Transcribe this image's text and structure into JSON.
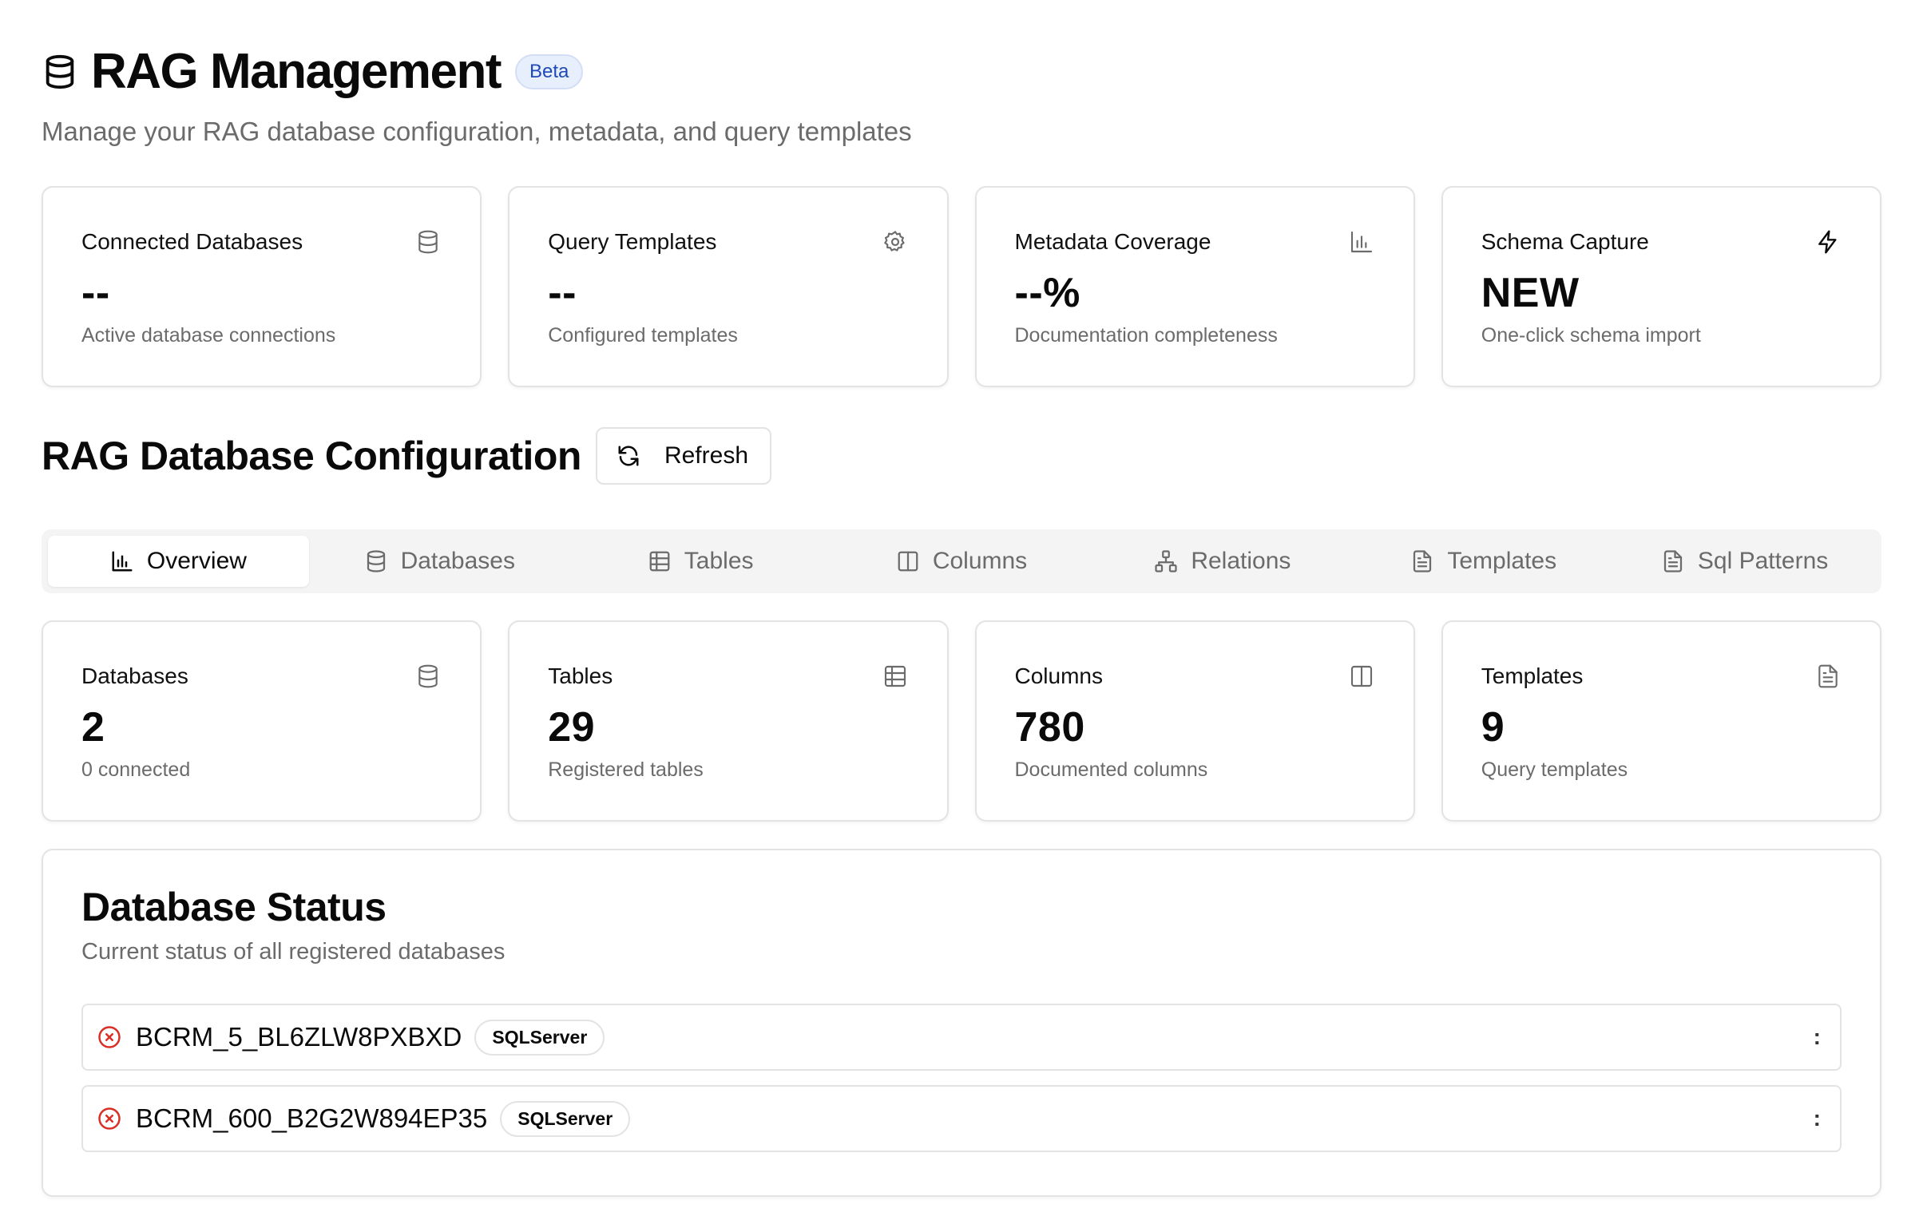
{
  "header": {
    "title": "RAG Management",
    "badge": "Beta",
    "subtitle": "Manage your RAG database configuration, metadata, and query templates"
  },
  "summary_cards": [
    {
      "title": "Connected Databases",
      "value": "--",
      "description": "Active database connections",
      "icon": "database-icon"
    },
    {
      "title": "Query Templates",
      "value": "--",
      "description": "Configured templates",
      "icon": "gear-icon"
    },
    {
      "title": "Metadata Coverage",
      "value": "--%",
      "description": "Documentation completeness",
      "icon": "bar-chart-icon"
    },
    {
      "title": "Schema Capture",
      "value": "NEW",
      "description": "One-click schema import",
      "icon": "lightning-icon"
    }
  ],
  "config": {
    "title": "RAG Database Configuration",
    "refresh_label": "Refresh"
  },
  "tabs": [
    {
      "label": "Overview",
      "icon": "bar-chart-icon",
      "active": true
    },
    {
      "label": "Databases",
      "icon": "database-icon",
      "active": false
    },
    {
      "label": "Tables",
      "icon": "table-icon",
      "active": false
    },
    {
      "label": "Columns",
      "icon": "columns-icon",
      "active": false
    },
    {
      "label": "Relations",
      "icon": "network-icon",
      "active": false
    },
    {
      "label": "Templates",
      "icon": "file-icon",
      "active": false
    },
    {
      "label": "Sql Patterns",
      "icon": "file-icon",
      "active": false
    }
  ],
  "overview_cards": [
    {
      "title": "Databases",
      "value": "2",
      "description": "0 connected",
      "icon": "database-icon"
    },
    {
      "title": "Tables",
      "value": "29",
      "description": "Registered tables",
      "icon": "table-icon"
    },
    {
      "title": "Columns",
      "value": "780",
      "description": "Documented columns",
      "icon": "columns-icon"
    },
    {
      "title": "Templates",
      "value": "9",
      "description": "Query templates",
      "icon": "file-icon"
    }
  ],
  "database_status": {
    "title": "Database Status",
    "subtitle": "Current status of all registered databases",
    "databases": [
      {
        "name": "BCRM_5_BL6ZLW8PXBXD",
        "type": "SQLServer",
        "status": "error",
        "menu": ":"
      },
      {
        "name": "BCRM_600_B2G2W894EP35",
        "type": "SQLServer",
        "status": "error",
        "menu": ":"
      }
    ]
  },
  "colors": {
    "accent_badge_bg": "#e8effc",
    "accent_badge_text": "#1f49b6",
    "error": "#d93025",
    "muted_text": "#6b6b6b"
  }
}
